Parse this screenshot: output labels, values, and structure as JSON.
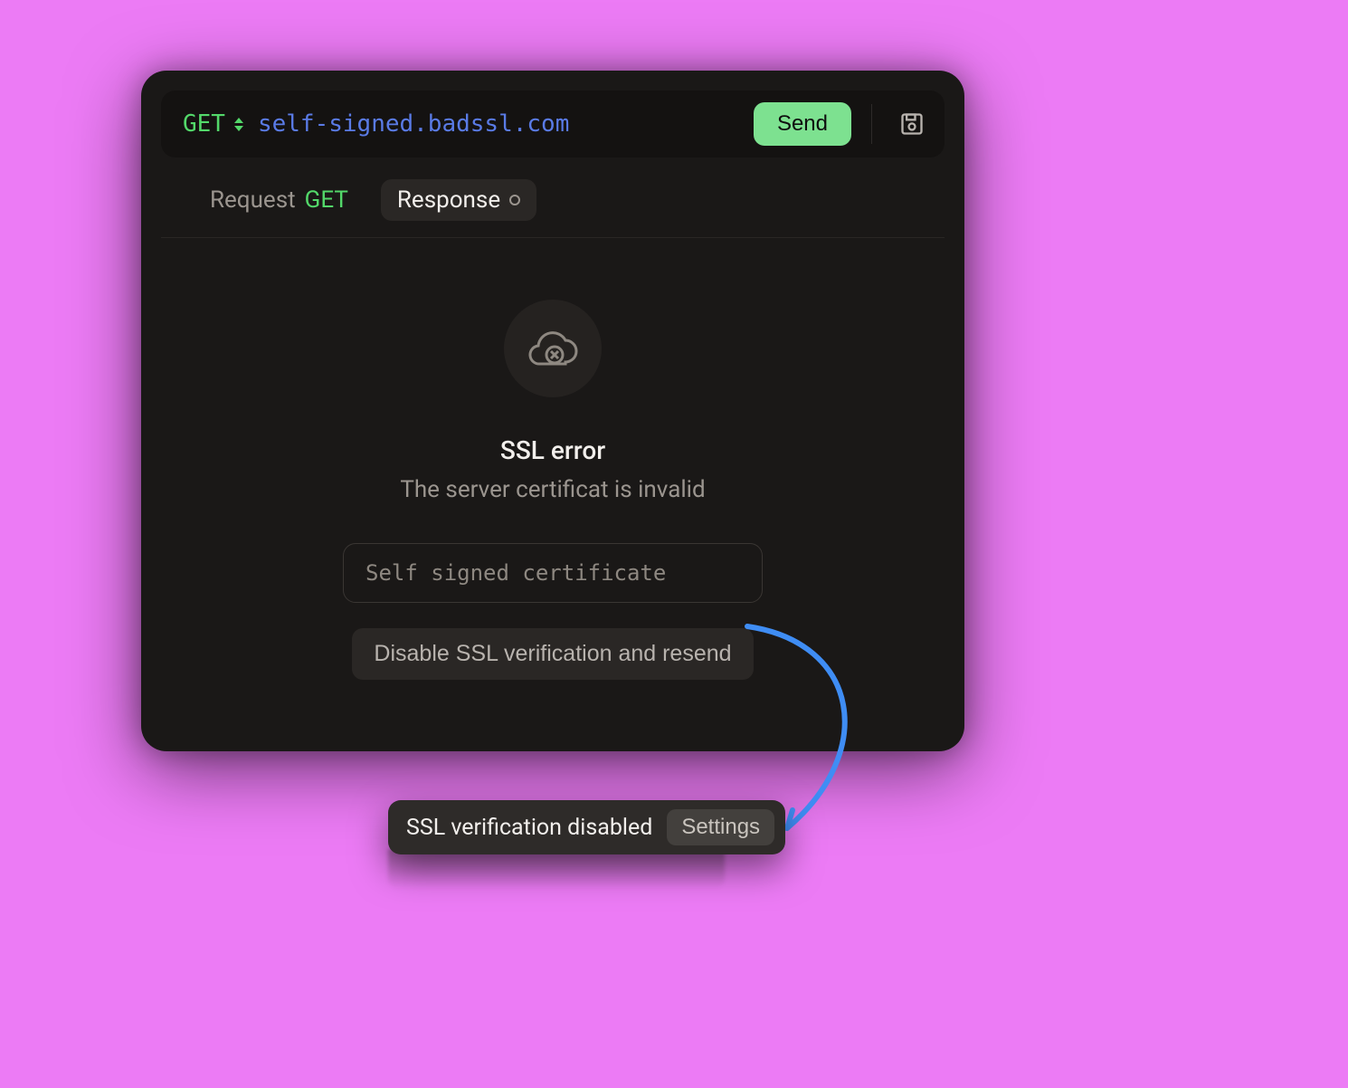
{
  "urlbar": {
    "method": "GET",
    "url": "self-signed.badssl.com",
    "send_label": "Send"
  },
  "tabs": {
    "request_label": "Request",
    "request_method": "GET",
    "response_label": "Response"
  },
  "error": {
    "title": "SSL error",
    "subtitle": "The server certificat is invalid",
    "reason": "Self signed certificate",
    "disable_button": "Disable SSL verification and resend"
  },
  "toast": {
    "text": "SSL verification disabled",
    "button": "Settings"
  }
}
